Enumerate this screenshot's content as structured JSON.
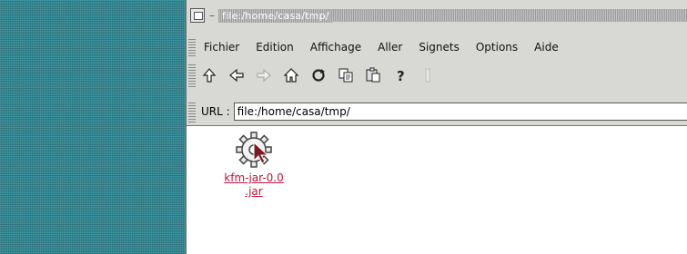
{
  "window": {
    "title": "file:/home/casa/tmp/"
  },
  "menubar": {
    "items": [
      "Fichier",
      "Edition",
      "Affichage",
      "Aller",
      "Signets",
      "Options",
      "Aide"
    ]
  },
  "toolbar": {
    "icons": [
      "up-icon",
      "back-icon",
      "forward-icon",
      "home-icon",
      "reload-icon",
      "copy-icon",
      "paste-icon",
      "help-icon",
      "stop-icon"
    ]
  },
  "urlbar": {
    "label": "URL :",
    "value": "file:/home/casa/tmp/"
  },
  "content": {
    "files": [
      {
        "name_line1": "kfm-jar-0.0",
        "name_line2": ".jar",
        "icon": "gear-icon"
      }
    ]
  },
  "colors": {
    "desktop": "#2f8a96",
    "window_bg": "#d8d8d4",
    "link": "#c0143c"
  }
}
